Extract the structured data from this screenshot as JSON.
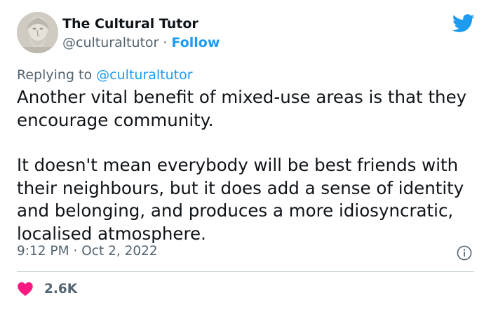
{
  "author": {
    "name": "The Cultural Tutor",
    "handle": "@culturaltutor",
    "separator": "·",
    "follow_label": "Follow"
  },
  "reply": {
    "prefix": "Replying to",
    "handle": "@culturaltutor"
  },
  "tweet": {
    "paragraphs": [
      "Another vital benefit of mixed-use areas is that they encourage community.",
      "It doesn't mean everybody will be best friends with their neighbours, but it does add a sense of identity and belonging, and produces a more idiosyncratic, localised atmosphere."
    ]
  },
  "meta": {
    "time": "9:12 PM",
    "separator": "·",
    "date": "Oct 2, 2022"
  },
  "engagement": {
    "likes": "2.6K"
  },
  "icons": {
    "logo": "twitter-bird-icon",
    "info": "info-icon",
    "like": "heart-icon"
  },
  "colors": {
    "brand_blue": "#1d9bf0",
    "heart_pink": "#f91880",
    "secondary_text": "#536471",
    "primary_text": "#0f1419"
  }
}
